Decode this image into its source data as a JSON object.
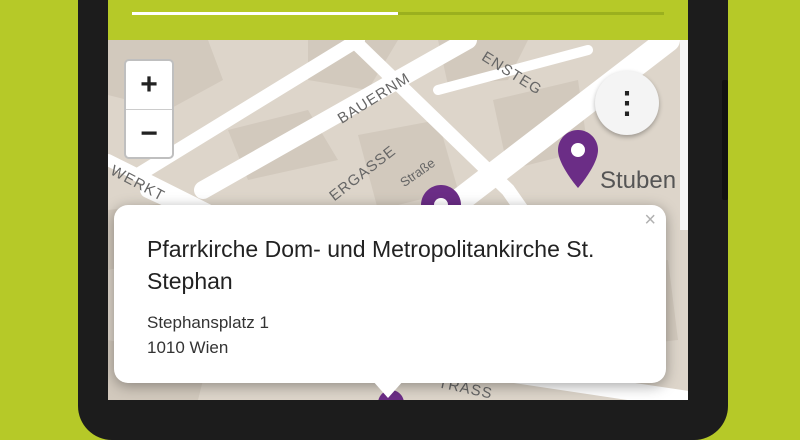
{
  "app": {
    "header_progress_percent": 50
  },
  "map": {
    "street_labels": [
      "BAUERNM",
      "ENSTEG",
      "ERGASSE",
      "WERKT",
      "Straße",
      "TRASS"
    ],
    "place_label": "Stuben",
    "zoom_in_label": "+",
    "zoom_out_label": "−",
    "more_menu_label": "⋮",
    "marker_color": "#6b2d86"
  },
  "popup": {
    "title": "Pfarrkirche Dom- und Metropolitankirche St. Stephan",
    "address_line1": "Stephansplatz 1",
    "address_line2": "1010 Wien",
    "close_label": "×"
  },
  "colors": {
    "accent": "#b6c928",
    "map_background": "#ddd5ca",
    "marker": "#6b2d86"
  }
}
